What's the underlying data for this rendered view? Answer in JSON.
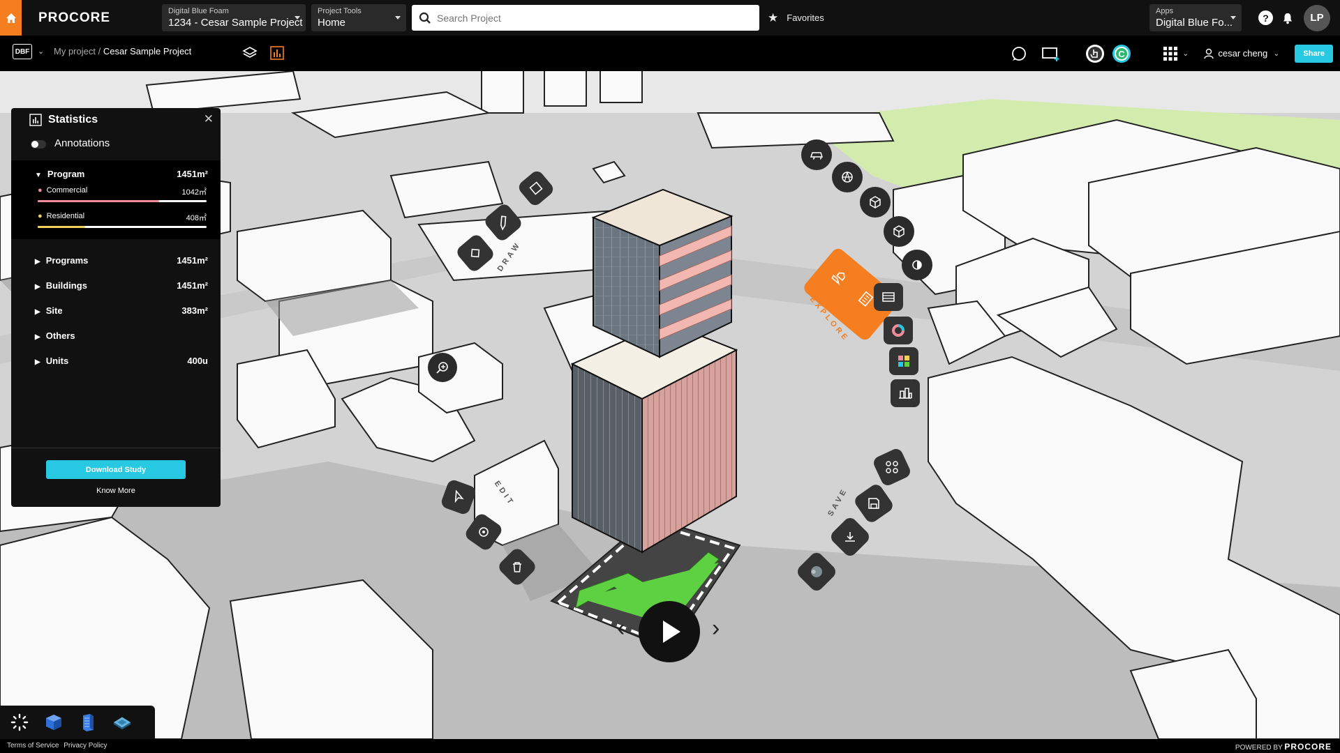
{
  "topbar": {
    "logo": "PROCORE",
    "company": {
      "small": "Digital Blue Foam",
      "big": "1234 - Cesar Sample Project"
    },
    "tools": {
      "small": "Project Tools",
      "big": "Home"
    },
    "search_placeholder": "Search Project",
    "favorites": "Favorites",
    "apps": {
      "small": "Apps",
      "big": "Digital Blue Fo..."
    },
    "help": "?",
    "avatar": "LP"
  },
  "secbar": {
    "dbf": "DBF",
    "crumb_parent": "My project",
    "crumb_sep": "/",
    "crumb_current": "Cesar Sample Project",
    "user": "cesar cheng",
    "share": "Share"
  },
  "stats": {
    "title": "Statistics",
    "annotations": "Annotations",
    "program": {
      "label": "Program",
      "value": "1451m²"
    },
    "commercial": {
      "label": "Commercial",
      "value": "1042㎡",
      "fraction": 0.72,
      "color": "#f08d9b"
    },
    "residential": {
      "label": "Residential",
      "value": "408㎡",
      "fraction": 0.28,
      "color": "#f2d15a"
    },
    "rows": [
      {
        "label": "Programs",
        "value": "1451m²"
      },
      {
        "label": "Buildings",
        "value": "1451m²"
      },
      {
        "label": "Site",
        "value": "383m²"
      },
      {
        "label": "Others",
        "value": ""
      },
      {
        "label": "Units",
        "value": "400u"
      }
    ],
    "download": "Download Study",
    "know_more": "Know More"
  },
  "radial": {
    "draw": "DRAW",
    "edit": "EDIT",
    "explore": "EXPLORE",
    "save": "SAVE"
  },
  "footer": {
    "terms": "Terms of Service",
    "privacy": "Privacy Policy",
    "powered": "POWERED BY",
    "brand": "PROCORE"
  },
  "colors": {
    "accent": "#f47e20",
    "cyan": "#27c9e2",
    "green": "#5ed142"
  }
}
